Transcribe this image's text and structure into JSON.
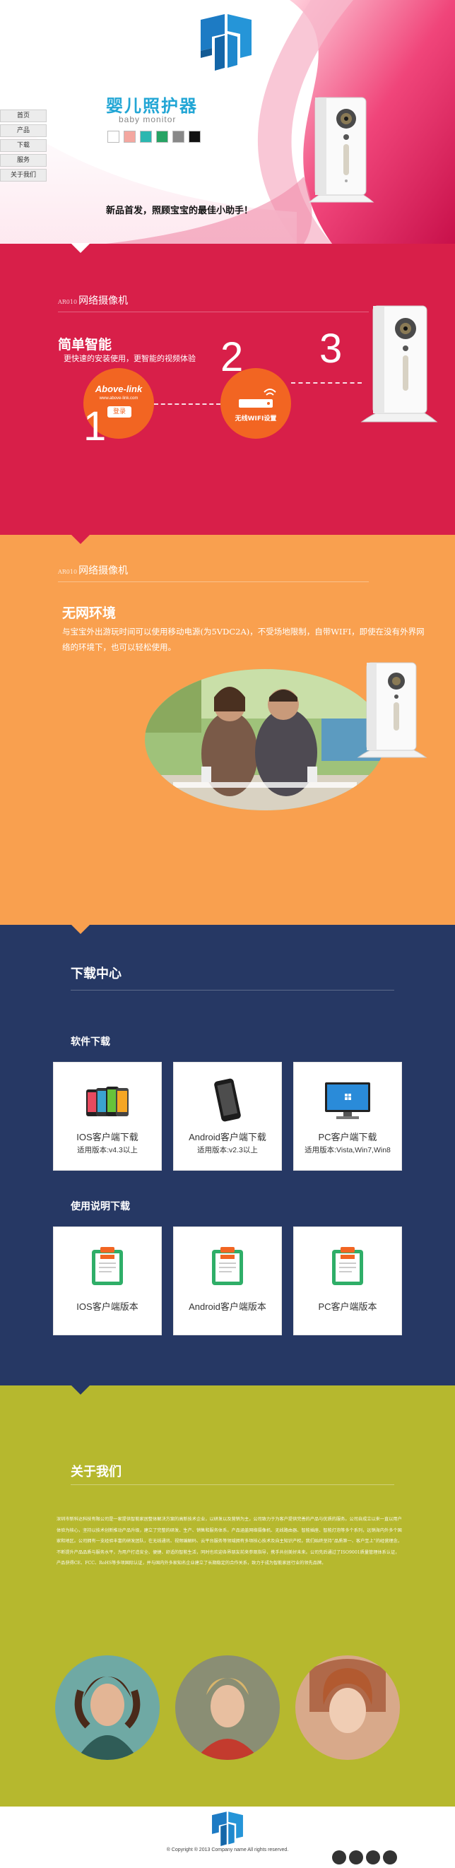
{
  "nav": {
    "items": [
      {
        "label": "首页"
      },
      {
        "label": "产品"
      },
      {
        "label": "下载"
      },
      {
        "label": "服务"
      },
      {
        "label": "关于我们"
      }
    ]
  },
  "hero": {
    "title": "婴儿照护器",
    "subtitle": "baby monitor",
    "tagline": "新品首发，照顾宝宝的最佳小助手！",
    "swatches": [
      "#ffffff",
      "#f4a7a0",
      "#2cb7b0",
      "#27a364",
      "#888888",
      "#111111"
    ]
  },
  "section1": {
    "model_code": "AR010",
    "model_name": "网络摄像机",
    "title": "简单智能",
    "desc": "更快速的安装使用，更智能的视频体验",
    "brand": "Above-link",
    "brand_url": "www.above-link.com",
    "login_label": "登录",
    "router_label": "无线WIFI设置",
    "steps": [
      "1",
      "2",
      "3"
    ]
  },
  "section2": {
    "model_code": "AR010",
    "model_name": "网络摄像机",
    "title": "无网环境",
    "desc": "与宝宝外出游玩时间可以使用移动电源(为5VDC2A)，不受场地限制，自带WIFI，即使在没有外界网络的环境下，也可以轻松使用。"
  },
  "download": {
    "title": "下载中心",
    "software_heading": "软件下载",
    "manual_heading": "使用说明下载",
    "software": [
      {
        "title": "IOS客户端下载",
        "version": "适用版本:v4.3以上"
      },
      {
        "title": "Android客户端下载",
        "version": "适用版本:v2.3以上"
      },
      {
        "title": "PC客户端下载",
        "version": "适用版本:Vista,Win7,Win8"
      }
    ],
    "manuals": [
      {
        "title": "IOS客户端版本"
      },
      {
        "title": "Android客户端版本"
      },
      {
        "title": "PC客户端版本"
      }
    ]
  },
  "about": {
    "title": "关于我们",
    "text": "深圳市新科达科技有限公司是一家提供智能家居整体解决方案的高新技术企业，以研发以及营销为主，公司致力于为客户提供完善的产品与优质的服务。公司自成立以来一直以用户体验为核心，坚持以技术创新推动产品升级，建立了完整的研发、生产、销售和服务体系，产品涵盖网络摄像机、无线路由器、智能插座、智能灯泡等多个系列，远销海内外多个国家和地区。公司拥有一支经验丰富的研发团队，在无线通讯、视频编解码、云平台服务等领域拥有多项核心技术及自主知识产权。我们始终坚持“品质第一、客户至上”的经营理念，不断提升产品品质与服务水平，为用户打造安全、便捷、舒适的智能生活，同时也欢迎各界朋友前来参观指导，携手共创美好未来。公司先后通过了ISO9001质量管理体系认证，产品获得CE、FCC、RoHS等多项国际认证，并与国内外多家知名企业建立了长期稳定的合作关系，致力于成为智能家居行业的领先品牌。"
  },
  "footer": {
    "copyright": "® Copyright ® 2013 Company name All rights reserved."
  },
  "colors": {
    "accent_blue": "#22a6d5",
    "section1_bg": "#d81f49",
    "section2_bg": "#f9a04f",
    "download_bg": "#263864",
    "about_bg": "#b6b82e",
    "step_orange": "#f26522"
  }
}
